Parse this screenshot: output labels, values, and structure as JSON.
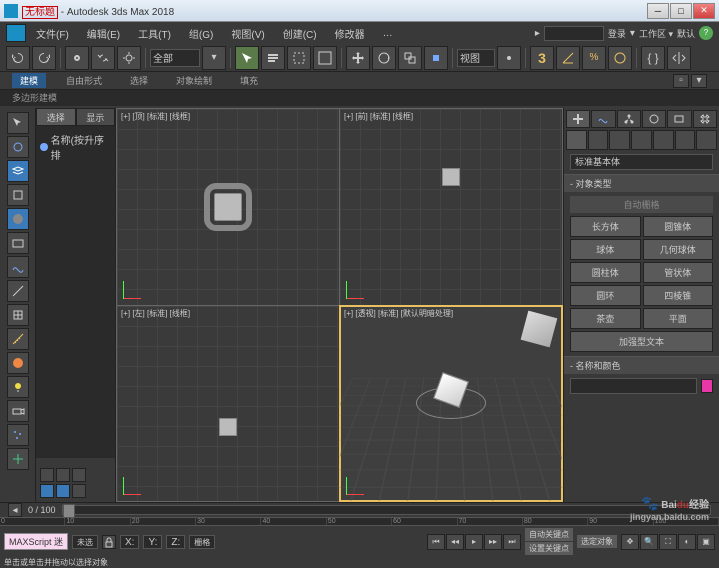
{
  "title_prefix": "无标题",
  "title_app": " - Autodesk 3ds Max 2018",
  "menu": [
    "文件(F)",
    "编辑(E)",
    "工具(T)",
    "组(G)",
    "视图(V)",
    "创建(C)",
    "修改器",
    "…"
  ],
  "menu_right": {
    "signin": "登录",
    "workspace": "工作区 ▾",
    "default": "默认"
  },
  "ribbon": {
    "tabs": [
      "建模",
      "自由形式",
      "选择",
      "对象绘制",
      "填充"
    ],
    "sub": "多边形建模"
  },
  "toolbar_selset": "全部",
  "scene": {
    "tab_sel": "选择",
    "tab_disp": "显示",
    "name_label": "名称(按升序排"
  },
  "viewports": {
    "top": "[+] [顶] [标准] [线框]",
    "front": "[+] [前] [标准] [线框]",
    "left": "[+] [左] [标准] [线框]",
    "persp": "[+] [透视] [标准] [默认明暗处理]"
  },
  "cmd": {
    "dropdown": "标准基本体",
    "rollout_type": "对象类型",
    "autogrid": "自动栅格",
    "prims": [
      "长方体",
      "圆锥体",
      "球体",
      "几何球体",
      "圆柱体",
      "管状体",
      "圆环",
      "四棱锥",
      "茶壶",
      "平面",
      "加强型文本"
    ],
    "rollout_name": "名称和颜色"
  },
  "time": {
    "frame": "0 / 100",
    "ticks": [
      "0",
      "10",
      "20",
      "30",
      "40",
      "50",
      "60",
      "70",
      "80",
      "90",
      "100"
    ]
  },
  "status": {
    "none": "未选",
    "x": "X:",
    "y": "Y:",
    "z": "Z:",
    "grid": "栅格",
    "autokey": "自动关键点",
    "key_filters": "选定对象",
    "setkey": "设置关键点",
    "maxscript": "MAXScript 迷",
    "prompt": "单击或单击并拖动以选择对象"
  },
  "watermark": {
    "main": "Bai",
    "du": "du",
    "jy": "经验",
    "url": "jingyan.baidu.com"
  }
}
